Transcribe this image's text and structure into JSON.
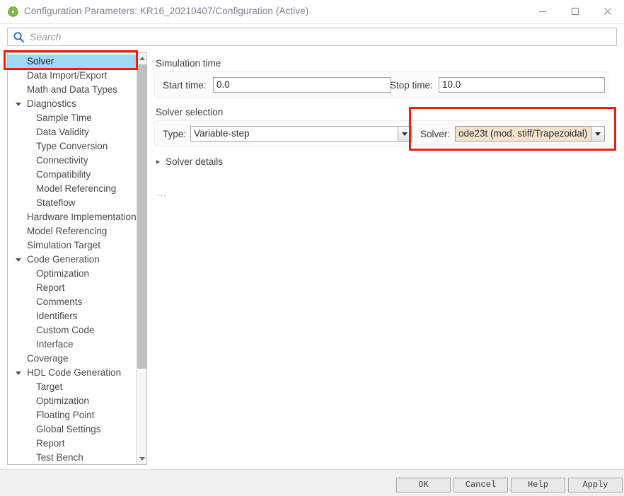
{
  "window": {
    "title": "Configuration Parameters: KR16_20210407/Configuration (Active)",
    "app_icon": "simulink-config-icon",
    "minimize_label": "–",
    "maximize_label": "□",
    "close_label": "✕"
  },
  "search": {
    "placeholder": "Search",
    "value": "",
    "icon": "search-icon"
  },
  "tree": {
    "selected": "Solver",
    "items": [
      {
        "label": "Solver",
        "level": 0,
        "twisty": "none",
        "selected": true
      },
      {
        "label": "Data Import/Export",
        "level": 0,
        "twisty": "none",
        "selected": false
      },
      {
        "label": "Math and Data Types",
        "level": 0,
        "twisty": "none",
        "selected": false
      },
      {
        "label": "Diagnostics",
        "level": 0,
        "twisty": "open",
        "selected": false
      },
      {
        "label": "Sample Time",
        "level": 1,
        "twisty": "none",
        "selected": false
      },
      {
        "label": "Data Validity",
        "level": 1,
        "twisty": "none",
        "selected": false
      },
      {
        "label": "Type Conversion",
        "level": 1,
        "twisty": "none",
        "selected": false
      },
      {
        "label": "Connectivity",
        "level": 1,
        "twisty": "none",
        "selected": false
      },
      {
        "label": "Compatibility",
        "level": 1,
        "twisty": "none",
        "selected": false
      },
      {
        "label": "Model Referencing",
        "level": 1,
        "twisty": "none",
        "selected": false
      },
      {
        "label": "Stateflow",
        "level": 1,
        "twisty": "none",
        "selected": false
      },
      {
        "label": "Hardware Implementation",
        "level": 0,
        "twisty": "none",
        "selected": false
      },
      {
        "label": "Model Referencing",
        "level": 0,
        "twisty": "none",
        "selected": false
      },
      {
        "label": "Simulation Target",
        "level": 0,
        "twisty": "none",
        "selected": false
      },
      {
        "label": "Code Generation",
        "level": 0,
        "twisty": "open",
        "selected": false
      },
      {
        "label": "Optimization",
        "level": 1,
        "twisty": "none",
        "selected": false
      },
      {
        "label": "Report",
        "level": 1,
        "twisty": "none",
        "selected": false
      },
      {
        "label": "Comments",
        "level": 1,
        "twisty": "none",
        "selected": false
      },
      {
        "label": "Identifiers",
        "level": 1,
        "twisty": "none",
        "selected": false
      },
      {
        "label": "Custom Code",
        "level": 1,
        "twisty": "none",
        "selected": false
      },
      {
        "label": "Interface",
        "level": 1,
        "twisty": "none",
        "selected": false
      },
      {
        "label": "Coverage",
        "level": 0,
        "twisty": "none",
        "selected": false
      },
      {
        "label": "HDL Code Generation",
        "level": 0,
        "twisty": "open",
        "selected": false
      },
      {
        "label": "Target",
        "level": 1,
        "twisty": "none",
        "selected": false
      },
      {
        "label": "Optimization",
        "level": 1,
        "twisty": "none",
        "selected": false
      },
      {
        "label": "Floating Point",
        "level": 1,
        "twisty": "none",
        "selected": false
      },
      {
        "label": "Global Settings",
        "level": 1,
        "twisty": "none",
        "selected": false
      },
      {
        "label": "Report",
        "level": 1,
        "twisty": "none",
        "selected": false
      },
      {
        "label": "Test Bench",
        "level": 1,
        "twisty": "none",
        "selected": false
      }
    ]
  },
  "main": {
    "simulation_time": {
      "group_label": "Simulation time",
      "start_time_label": "Start time:",
      "start_time_value": "0.0",
      "stop_time_label": "Stop time:",
      "stop_time_value": "10.0"
    },
    "solver_selection": {
      "group_label": "Solver selection",
      "type_label": "Type:",
      "type_value": "Variable-step",
      "solver_label": "Solver:",
      "solver_value": "ode23t (mod. stiff/Trapezoidal)"
    },
    "solver_details_label": "Solver details",
    "ellipsis": "..."
  },
  "footer": {
    "ok_label": "OK",
    "cancel_label": "Cancel",
    "help_label": "Help",
    "apply_label": "Apply"
  },
  "annotations": {
    "highlight_color": "#f51b10",
    "boxes": [
      {
        "name": "solver-tree-item-highlight"
      },
      {
        "name": "solver-dropdown-highlight"
      }
    ]
  }
}
